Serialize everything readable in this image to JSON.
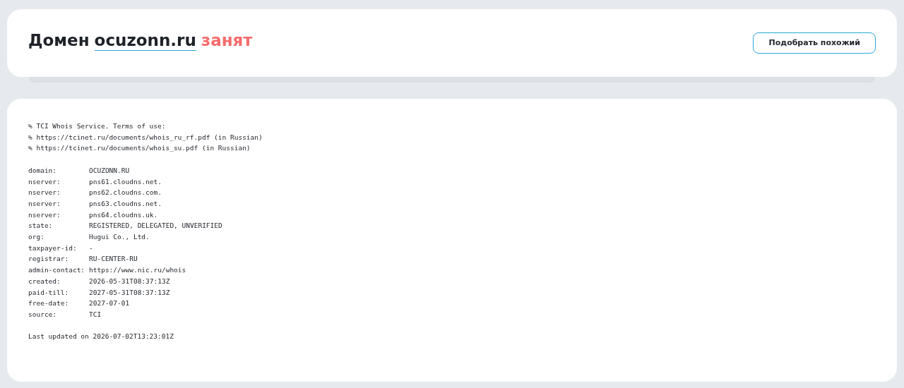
{
  "header": {
    "title_prefix": "Домен",
    "domain": "ocuzonn.ru",
    "status": "занят",
    "button": "Подобрать похожий"
  },
  "whois": {
    "notice": [
      "% TCI Whois Service. Terms of use:",
      "% https://tcinet.ru/documents/whois_ru_rf.pdf (in Russian)",
      "% https://tcinet.ru/documents/whois_su.pdf (in Russian)"
    ],
    "records": [
      {
        "key": "domain:",
        "value": "OCUZONN.RU"
      },
      {
        "key": "nserver:",
        "value": "pns61.cloudns.net."
      },
      {
        "key": "nserver:",
        "value": "pns62.cloudns.com."
      },
      {
        "key": "nserver:",
        "value": "pns63.cloudns.net."
      },
      {
        "key": "nserver:",
        "value": "pns64.cloudns.uk."
      },
      {
        "key": "state:",
        "value": "REGISTERED, DELEGATED, UNVERIFIED"
      },
      {
        "key": "org:",
        "value": "Hugui Co., Ltd."
      },
      {
        "key": "taxpayer-id:",
        "value": "-"
      },
      {
        "key": "registrar:",
        "value": "RU-CENTER-RU"
      },
      {
        "key": "admin-contact:",
        "value": "https://www.nic.ru/whois"
      },
      {
        "key": "created:",
        "value": "2026-05-31T08:37:13Z"
      },
      {
        "key": "paid-till:",
        "value": "2027-05-31T08:37:13Z"
      },
      {
        "key": "free-date:",
        "value": "2027-07-01"
      },
      {
        "key": "source:",
        "value": "TCI"
      }
    ],
    "footer": "Last updated on 2026-07-02T13:23:01Z"
  }
}
